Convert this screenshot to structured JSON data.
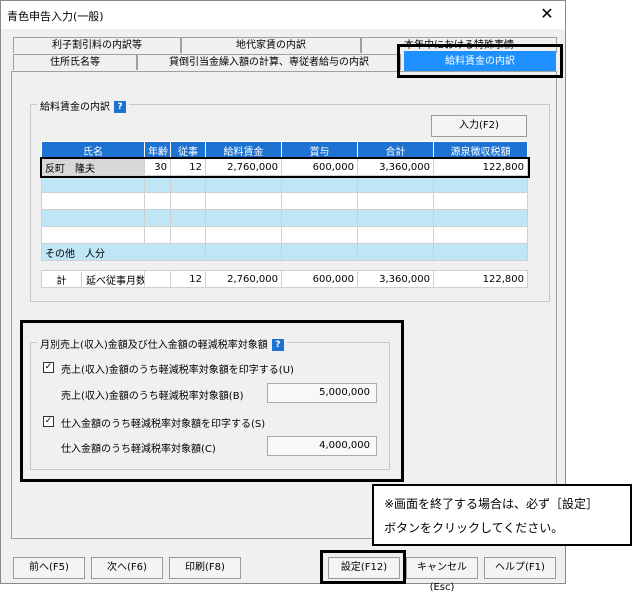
{
  "window": {
    "title": "青色申告入力(一般)",
    "close_glyph": "✕"
  },
  "tabs": {
    "row1": [
      "利子割引料の内訳等",
      "地代家賃の内訳",
      "本年中における特殊事情"
    ],
    "row2": [
      "住所氏名等",
      "貸倒引当金繰入額の計算、専従者給与の内訳",
      "給料賃金の内訳"
    ],
    "active": "給料賃金の内訳"
  },
  "salary": {
    "group_title": "給料賃金の内訳",
    "help": "?",
    "input_button": "入力(F2)",
    "columns": [
      "氏名",
      "年齢",
      "従事",
      "給料賃金",
      "賞与",
      "合計",
      "源泉徴収税額"
    ],
    "rows": [
      [
        "反町　隆夫",
        "30",
        "12",
        "2,760,000",
        "600,000",
        "3,360,000",
        "122,800"
      ],
      [
        "",
        "",
        "",
        "",
        "",
        "",
        ""
      ],
      [
        "",
        "",
        "",
        "",
        "",
        "",
        ""
      ],
      [
        "",
        "",
        "",
        "",
        "",
        "",
        ""
      ],
      [
        "",
        "",
        "",
        "",
        "",
        "",
        ""
      ]
    ],
    "other_row_label": "その他　人分",
    "total": {
      "label": "計",
      "months_label": "延べ従事月数",
      "months": "12",
      "salary": "2,760,000",
      "bonus": "600,000",
      "sum": "3,360,000",
      "tax": "122,800"
    }
  },
  "reduced_tax": {
    "group_title": "月別売上(収入)金額及び仕入金額の軽減税率対象額",
    "help": "?",
    "sales_check_label": "売上(収入)金額のうち軽減税率対象額を印字する(U)",
    "sales_checked": true,
    "sales_field_label": "売上(収入)金額のうち軽減税率対象額(B)",
    "sales_value": "5,000,000",
    "purchase_check_label": "仕入金額のうち軽減税率対象額を印字する(S)",
    "purchase_checked": true,
    "purchase_field_label": "仕入金額のうち軽減税率対象額(C)",
    "purchase_value": "4,000,000",
    "check_glyph": "✓"
  },
  "buttons": {
    "prev": "前へ(F5)",
    "next": "次へ(F6)",
    "print": "印刷(F8)",
    "settings": "設定(F12)",
    "cancel": "キャンセル(Esc)",
    "help": "ヘルプ(F1)"
  },
  "note": {
    "line1": "※画面を終了する場合は、必ず［設定］",
    "line2": "ボタンをクリックしてください。"
  }
}
